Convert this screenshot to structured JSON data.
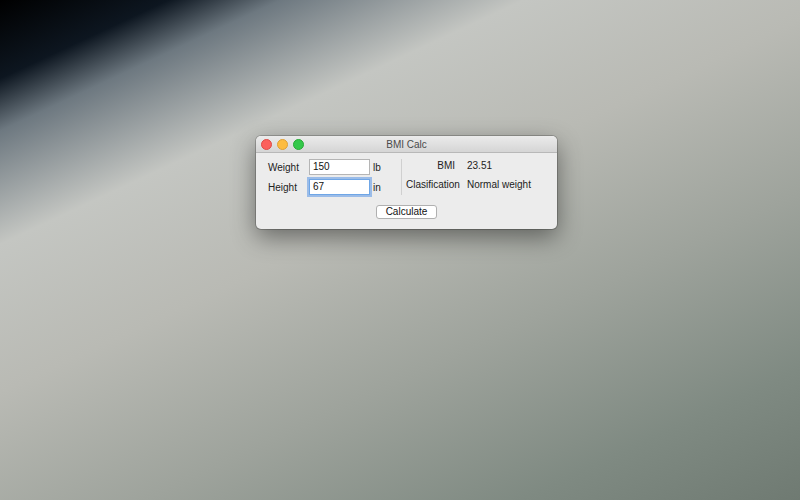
{
  "window": {
    "title": "BMI Calc"
  },
  "inputs": [
    {
      "label": "Weight",
      "value": "150",
      "unit": "lb",
      "focused": false
    },
    {
      "label": "Height",
      "value": "67",
      "unit": "in",
      "focused": true
    }
  ],
  "results": [
    {
      "label": "BMI",
      "value": "23.51"
    },
    {
      "label": "Clasification",
      "value": "Normal weight"
    }
  ],
  "buttons": [
    "Calculate"
  ]
}
